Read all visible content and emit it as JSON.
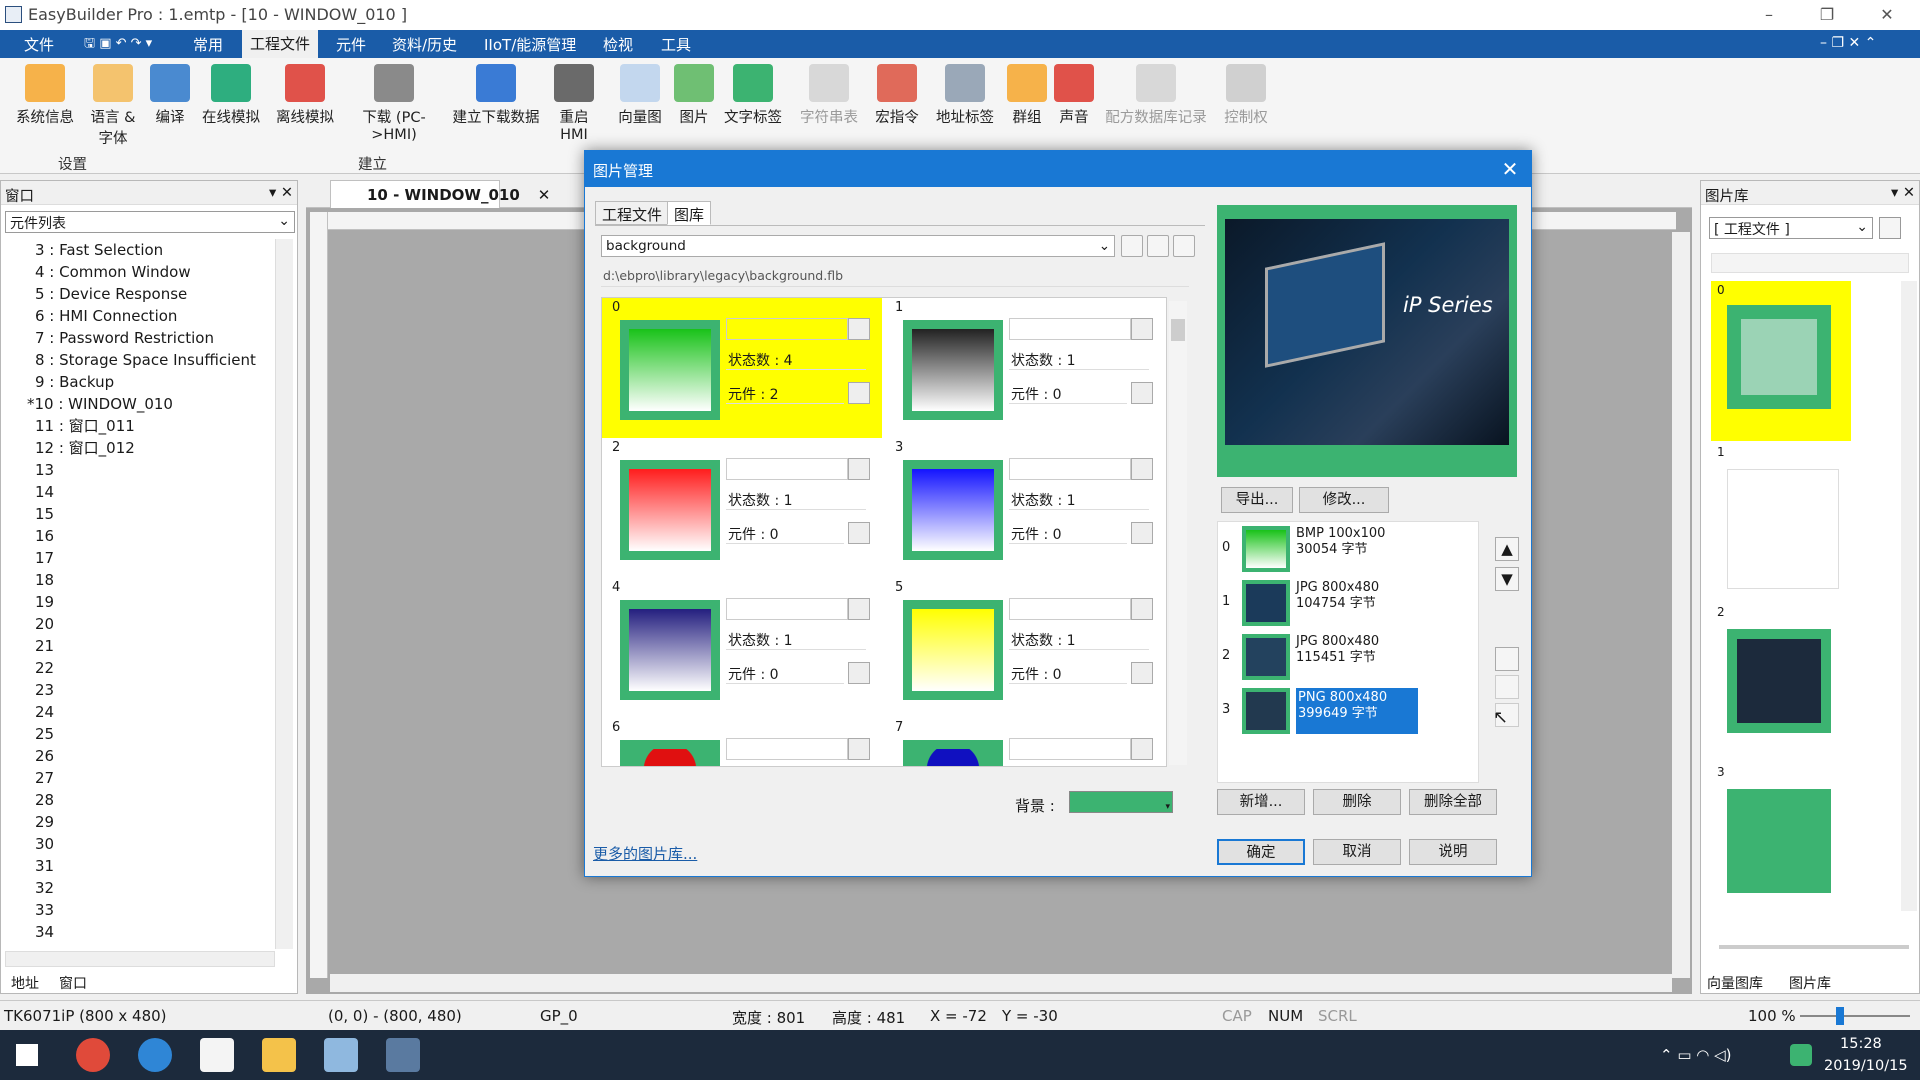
{
  "window_title": "EasyBuilder Pro : 1.emtp - [10 - WINDOW_010 ]",
  "menus": [
    "文件",
    "常用",
    "工程文件",
    "元件",
    "资料/历史",
    "IIoT/能源管理",
    "检视",
    "工具"
  ],
  "ribbon": {
    "buttons": [
      "系统信息",
      "语言 & 字体",
      "编译",
      "在线模拟",
      "离线模拟",
      "下载 (PC->HMI)",
      "建立下载数据",
      "重启 HMI",
      "向量图",
      "图片",
      "文字标签",
      "字符串表",
      "宏指令",
      "地址标签",
      "群组",
      "声音",
      "配方数据库记录",
      "控制权"
    ],
    "groups": [
      "设置",
      "建立"
    ]
  },
  "left_panel": {
    "title": "窗口",
    "select": "元件列表",
    "items": [
      "3 : Fast Selection",
      "4 : Common Window",
      "5 : Device Response",
      "6 : HMI Connection",
      "7 : Password Restriction",
      "8 : Storage Space Insufficient",
      "9 : Backup",
      "*10 : WINDOW_010",
      "11 : 窗口_011",
      "12 : 窗口_012",
      "13",
      "14",
      "15",
      "16",
      "17",
      "18",
      "19",
      "20",
      "21",
      "22",
      "23",
      "24",
      "25",
      "26",
      "27",
      "28",
      "29",
      "30",
      "31",
      "32",
      "33",
      "34"
    ],
    "bottom_tabs": [
      "地址",
      "窗口"
    ]
  },
  "doc_tab": "10 - WINDOW_010",
  "right_panel": {
    "title": "图片库",
    "select": "[ 工程文件 ]",
    "items": [
      "0",
      "1",
      "2",
      "3"
    ],
    "bottom_tabs": [
      "向量图库",
      "图片库"
    ]
  },
  "dialog": {
    "title": "图片管理",
    "tabs": [
      "工程文件",
      "图库"
    ],
    "library": "background",
    "path": "d:\\ebpro\\library\\legacy\\background.flb",
    "cells": [
      {
        "idx": "0",
        "states": "状态数 : 4",
        "parts": "元件 : 2"
      },
      {
        "idx": "1",
        "states": "状态数 : 1",
        "parts": "元件 : 0"
      },
      {
        "idx": "2",
        "states": "状态数 : 1",
        "parts": "元件 : 0"
      },
      {
        "idx": "3",
        "states": "状态数 : 1",
        "parts": "元件 : 0"
      },
      {
        "idx": "4",
        "states": "状态数 : 1",
        "parts": "元件 : 0"
      },
      {
        "idx": "5",
        "states": "状态数 : 1",
        "parts": "元件 : 0"
      },
      {
        "idx": "6",
        "states": "",
        "parts": ""
      },
      {
        "idx": "7",
        "states": "",
        "parts": ""
      }
    ],
    "preview_text": "iP Series",
    "export": "导出...",
    "modify": "修改...",
    "files": [
      {
        "n": "0",
        "l1": "BMP 100x100",
        "l2": "30054 字节"
      },
      {
        "n": "1",
        "l1": "JPG 800x480",
        "l2": "104754 字节"
      },
      {
        "n": "2",
        "l1": "JPG 800x480",
        "l2": "115451 字节"
      },
      {
        "n": "3",
        "l1": "PNG 800x480",
        "l2": "399649 字节"
      }
    ],
    "bg_label": "背景 :",
    "add": "新增...",
    "delete": "删除",
    "delete_all": "删除全部",
    "more": "更多的图片库...",
    "ok": "确定",
    "cancel": "取消",
    "help": "说明"
  },
  "status": {
    "model": "TK6071iP (800 x 480)",
    "range": "(0, 0) - (800, 480)",
    "gp": "GP_0",
    "width": "宽度 : 801",
    "height": "高度 : 481",
    "x": "X = -72",
    "y": "Y = -30",
    "cap": "CAP",
    "num": "NUM",
    "scrl": "SCRL",
    "zoom": "100 %"
  },
  "taskbar": {
    "time": "15:28",
    "date": "2019/10/15"
  }
}
